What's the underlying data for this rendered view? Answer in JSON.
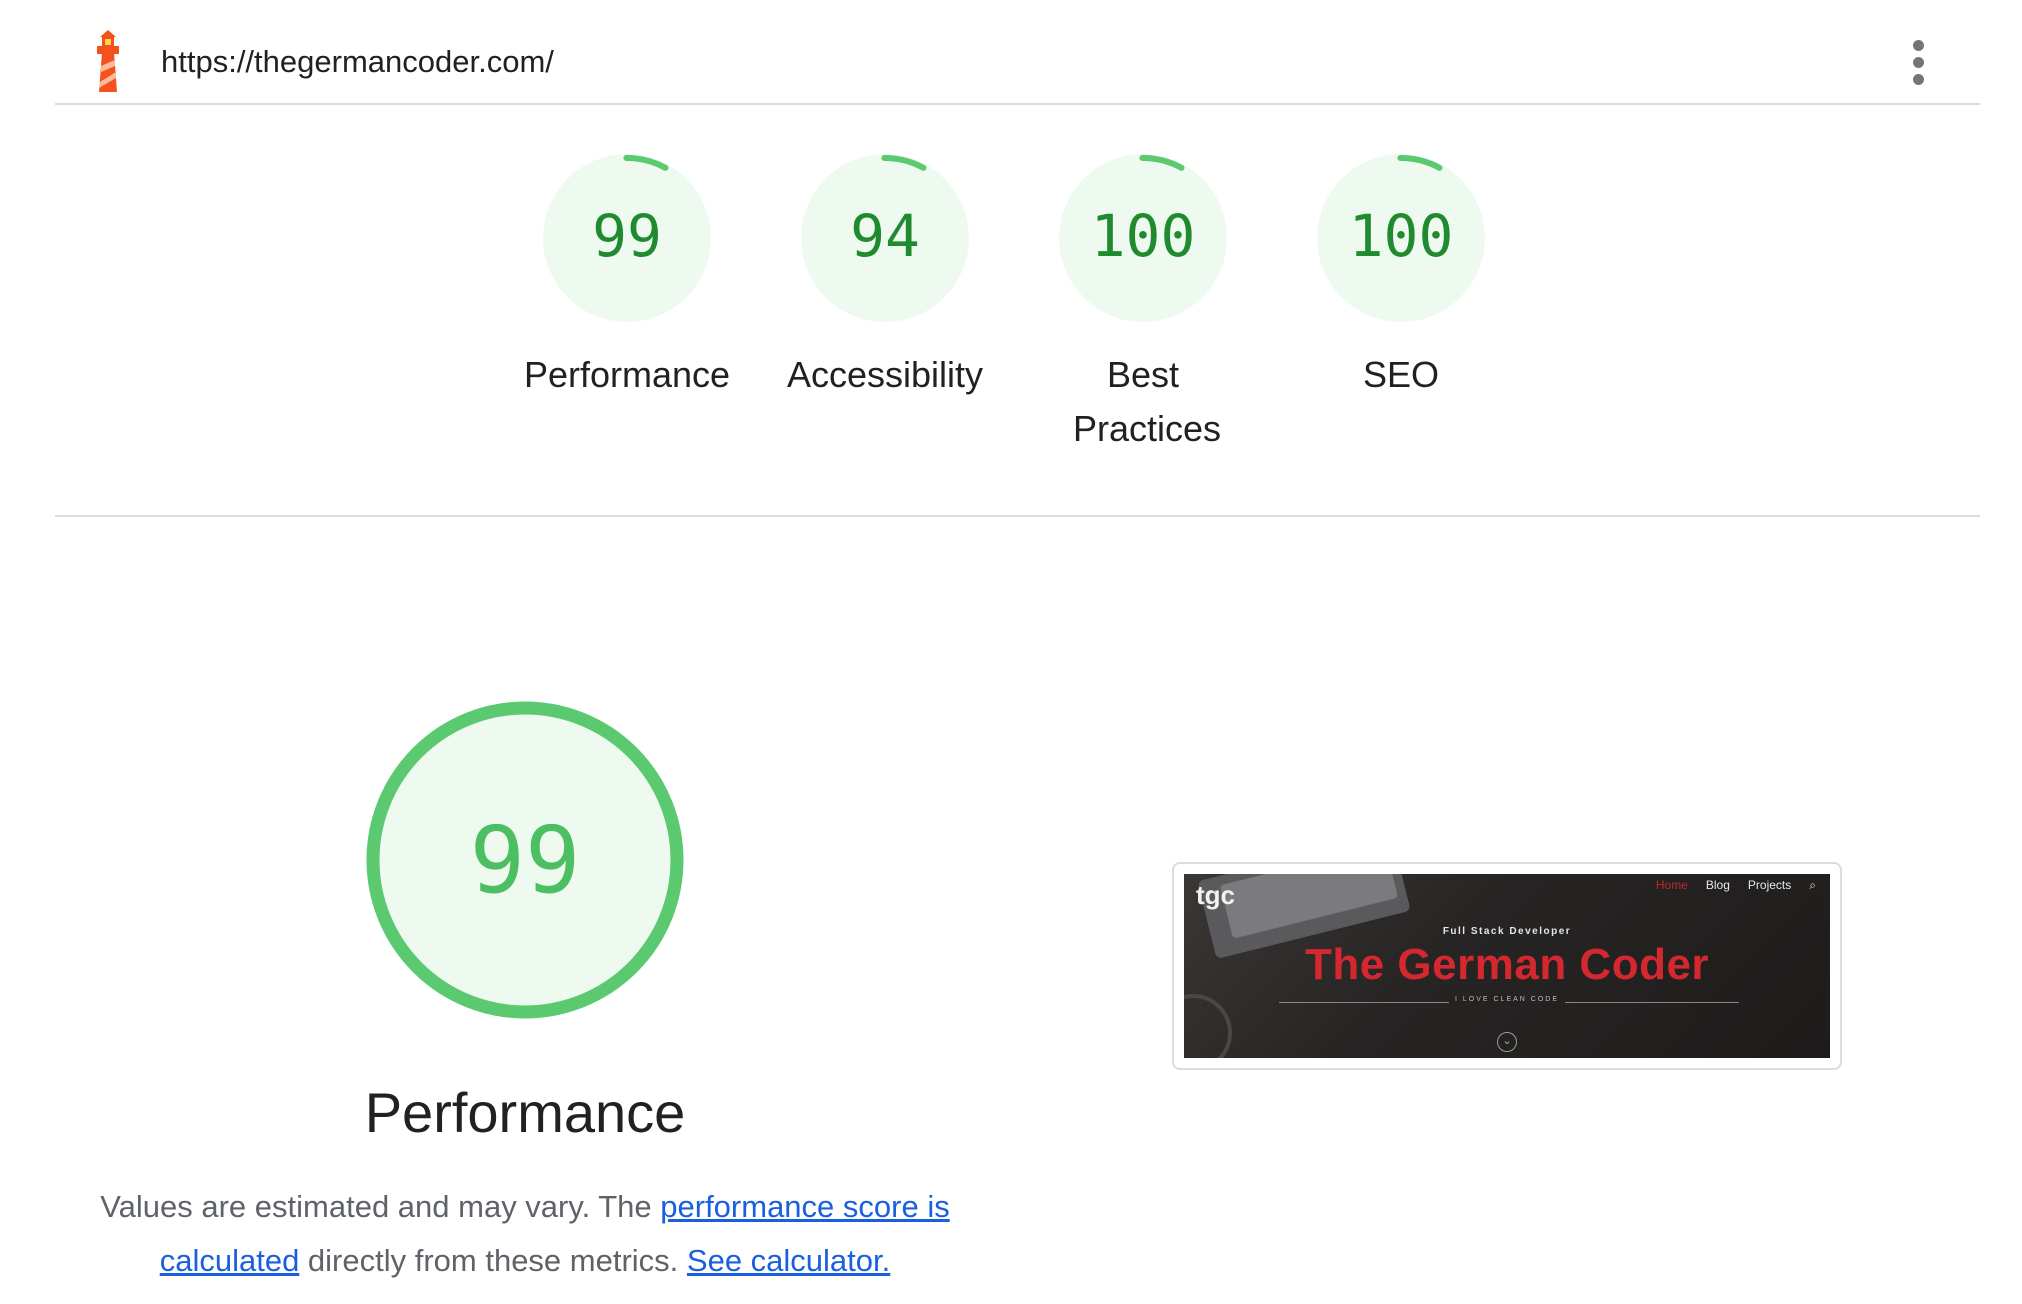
{
  "header": {
    "url": "https://thegermancoder.com/",
    "logo_icon": "lighthouse-icon",
    "menu_icon": "more-vert-icon"
  },
  "scores": [
    {
      "value": "99",
      "label": "Performance"
    },
    {
      "value": "94",
      "label": "Accessibility"
    },
    {
      "value": "100",
      "label": "Best Practices"
    },
    {
      "value": "100",
      "label": "SEO"
    }
  ],
  "performance": {
    "score": "99",
    "title": "Performance",
    "desc_prefix": "Values are estimated and may vary. The ",
    "link_score": "performance score is calculated",
    "desc_middle": " directly from these metrics. ",
    "link_calculator": "See calculator."
  },
  "screenshot": {
    "brand": "tgc",
    "nav": [
      "Home",
      "Blog",
      "Projects"
    ],
    "search_icon": "search-icon",
    "kicker": "Full Stack Developer",
    "headline": "The German Coder",
    "tagline": "I LOVE CLEAN CODE",
    "scroll_icon": "chevron-down-icon"
  },
  "colors": {
    "pass_ring": "#5bc96f",
    "pass_fill": "#eefaf0",
    "pass_text": "#1f8a2e",
    "link": "#1a5fe0",
    "brand_red": "#d4272f"
  }
}
